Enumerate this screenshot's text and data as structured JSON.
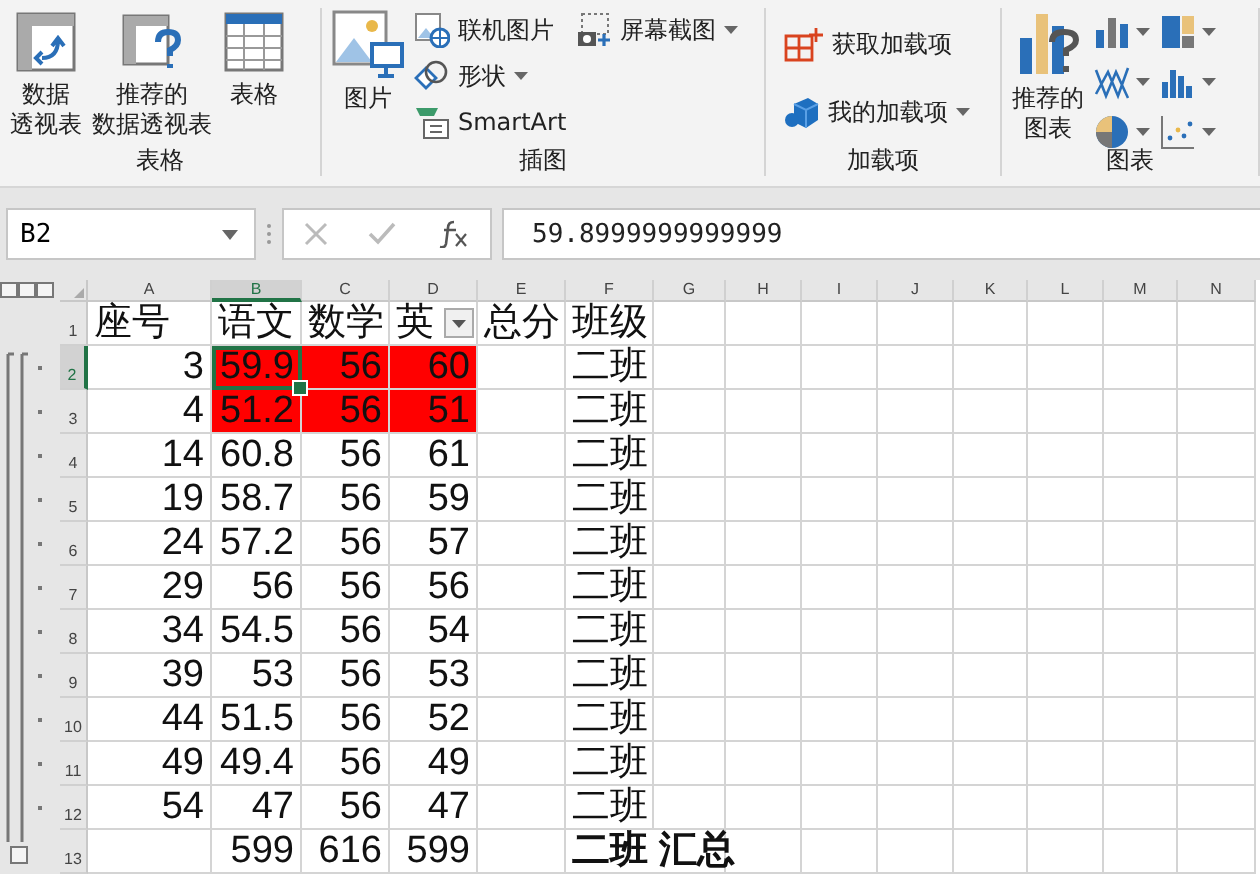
{
  "ribbon": {
    "groups": [
      {
        "label": "表格",
        "items": [
          {
            "kind": "large",
            "label_lines": [
              "数据",
              "透视表"
            ]
          },
          {
            "kind": "large",
            "label_lines": [
              "推荐的",
              "数据透视表"
            ]
          },
          {
            "kind": "large",
            "label_lines": [
              "表格"
            ]
          }
        ]
      },
      {
        "label": "插图",
        "items": [
          {
            "kind": "large",
            "label_lines": [
              "图片"
            ]
          },
          {
            "kind": "stack",
            "items": [
              {
                "kind": "small",
                "label": "联机图片",
                "dropdown": false
              },
              {
                "kind": "small",
                "label": "形状",
                "dropdown": true
              },
              {
                "kind": "small",
                "label": "SmartArt",
                "dropdown": false
              }
            ]
          },
          {
            "kind": "stack",
            "items": [
              {
                "kind": "small",
                "label": "屏幕截图",
                "dropdown": true
              }
            ]
          }
        ]
      },
      {
        "label": "加载项",
        "items": [
          {
            "kind": "stack",
            "items": [
              {
                "kind": "small",
                "label": "获取加载项",
                "dropdown": false
              },
              {
                "kind": "small",
                "label": "我的加载项",
                "dropdown": true
              }
            ]
          }
        ]
      },
      {
        "label": "图表",
        "items": [
          {
            "kind": "large",
            "label_lines": [
              "推荐的",
              "图表"
            ]
          },
          {
            "kind": "stack",
            "items": [
              {
                "kind": "iconbtn",
                "dropdown": true
              },
              {
                "kind": "iconbtn",
                "dropdown": true
              },
              {
                "kind": "iconbtn",
                "dropdown": true
              }
            ]
          },
          {
            "kind": "stack",
            "items": [
              {
                "kind": "iconbtn",
                "dropdown": true
              },
              {
                "kind": "iconbtn",
                "dropdown": true
              },
              {
                "kind": "iconbtn",
                "dropdown": true
              }
            ]
          }
        ]
      }
    ]
  },
  "formula_bar": {
    "name_box": "B2",
    "formula": "59.8999999999999"
  },
  "sheet": {
    "columns": [
      {
        "letter": "A",
        "selected": false
      },
      {
        "letter": "B",
        "selected": true
      },
      {
        "letter": "C",
        "selected": false
      },
      {
        "letter": "D",
        "selected": false
      },
      {
        "letter": "E",
        "selected": false
      },
      {
        "letter": "F",
        "selected": false
      },
      {
        "letter": "G",
        "selected": false
      },
      {
        "letter": "H",
        "selected": false
      },
      {
        "letter": "I",
        "selected": false
      },
      {
        "letter": "J",
        "selected": false
      },
      {
        "letter": "K",
        "selected": false
      },
      {
        "letter": "L",
        "selected": false
      },
      {
        "letter": "M",
        "selected": false
      },
      {
        "letter": "N",
        "selected": false
      }
    ],
    "rows": [
      {
        "number": "1",
        "selected": false,
        "kind": "header",
        "cells": {
          "A": {
            "text": "座号"
          },
          "B": {
            "text": "语文"
          },
          "C": {
            "text": "数学"
          },
          "D": {
            "text": "英",
            "filter": true
          },
          "E": {
            "text": "总分"
          },
          "F": {
            "text": "班级"
          }
        }
      },
      {
        "number": "2",
        "selected": true,
        "kind": "detail",
        "cells": {
          "A": {
            "text": "3",
            "kind": "number"
          },
          "B": {
            "text": "59.9",
            "kind": "number",
            "highlighted": true,
            "selected": true
          },
          "C": {
            "text": "56",
            "kind": "number",
            "highlighted": true
          },
          "D": {
            "text": "60",
            "kind": "number",
            "highlighted": true
          },
          "F": {
            "text": "二班"
          }
        }
      },
      {
        "number": "3",
        "selected": false,
        "kind": "detail",
        "cells": {
          "A": {
            "text": "4",
            "kind": "number"
          },
          "B": {
            "text": "51.2",
            "kind": "number",
            "highlighted": true
          },
          "C": {
            "text": "56",
            "kind": "number",
            "highlighted": true
          },
          "D": {
            "text": "51",
            "kind": "number",
            "highlighted": true
          },
          "F": {
            "text": "二班"
          }
        }
      },
      {
        "number": "4",
        "selected": false,
        "kind": "detail",
        "cells": {
          "A": {
            "text": "14",
            "kind": "number"
          },
          "B": {
            "text": "60.8",
            "kind": "number"
          },
          "C": {
            "text": "56",
            "kind": "number"
          },
          "D": {
            "text": "61",
            "kind": "number"
          },
          "F": {
            "text": "二班"
          }
        }
      },
      {
        "number": "5",
        "selected": false,
        "kind": "detail",
        "cells": {
          "A": {
            "text": "19",
            "kind": "number"
          },
          "B": {
            "text": "58.7",
            "kind": "number"
          },
          "C": {
            "text": "56",
            "kind": "number"
          },
          "D": {
            "text": "59",
            "kind": "number"
          },
          "F": {
            "text": "二班"
          }
        }
      },
      {
        "number": "6",
        "selected": false,
        "kind": "detail",
        "cells": {
          "A": {
            "text": "24",
            "kind": "number"
          },
          "B": {
            "text": "57.2",
            "kind": "number"
          },
          "C": {
            "text": "56",
            "kind": "number"
          },
          "D": {
            "text": "57",
            "kind": "number"
          },
          "F": {
            "text": "二班"
          }
        }
      },
      {
        "number": "7",
        "selected": false,
        "kind": "detail",
        "cells": {
          "A": {
            "text": "29",
            "kind": "number"
          },
          "B": {
            "text": "56",
            "kind": "number"
          },
          "C": {
            "text": "56",
            "kind": "number"
          },
          "D": {
            "text": "56",
            "kind": "number"
          },
          "F": {
            "text": "二班"
          }
        }
      },
      {
        "number": "8",
        "selected": false,
        "kind": "detail",
        "cells": {
          "A": {
            "text": "34",
            "kind": "number"
          },
          "B": {
            "text": "54.5",
            "kind": "number"
          },
          "C": {
            "text": "56",
            "kind": "number"
          },
          "D": {
            "text": "54",
            "kind": "number"
          },
          "F": {
            "text": "二班"
          }
        }
      },
      {
        "number": "9",
        "selected": false,
        "kind": "detail",
        "cells": {
          "A": {
            "text": "39",
            "kind": "number"
          },
          "B": {
            "text": "53",
            "kind": "number"
          },
          "C": {
            "text": "56",
            "kind": "number"
          },
          "D": {
            "text": "53",
            "kind": "number"
          },
          "F": {
            "text": "二班"
          }
        }
      },
      {
        "number": "10",
        "selected": false,
        "kind": "detail",
        "cells": {
          "A": {
            "text": "44",
            "kind": "number"
          },
          "B": {
            "text": "51.5",
            "kind": "number"
          },
          "C": {
            "text": "56",
            "kind": "number"
          },
          "D": {
            "text": "52",
            "kind": "number"
          },
          "F": {
            "text": "二班"
          }
        }
      },
      {
        "number": "11",
        "selected": false,
        "kind": "detail",
        "cells": {
          "A": {
            "text": "49",
            "kind": "number"
          },
          "B": {
            "text": "49.4",
            "kind": "number"
          },
          "C": {
            "text": "56",
            "kind": "number"
          },
          "D": {
            "text": "49",
            "kind": "number"
          },
          "F": {
            "text": "二班"
          }
        }
      },
      {
        "number": "12",
        "selected": false,
        "kind": "detail",
        "cells": {
          "A": {
            "text": "54",
            "kind": "number"
          },
          "B": {
            "text": "47",
            "kind": "number"
          },
          "C": {
            "text": "56",
            "kind": "number"
          },
          "D": {
            "text": "47",
            "kind": "number"
          },
          "F": {
            "text": "二班"
          }
        }
      },
      {
        "number": "13",
        "selected": false,
        "kind": "summary",
        "cells": {
          "B": {
            "text": "599",
            "kind": "number"
          },
          "C": {
            "text": "616",
            "kind": "number"
          },
          "D": {
            "text": "599",
            "kind": "number"
          },
          "F": {
            "text": "二班 汇总",
            "bold": true
          }
        }
      }
    ]
  }
}
